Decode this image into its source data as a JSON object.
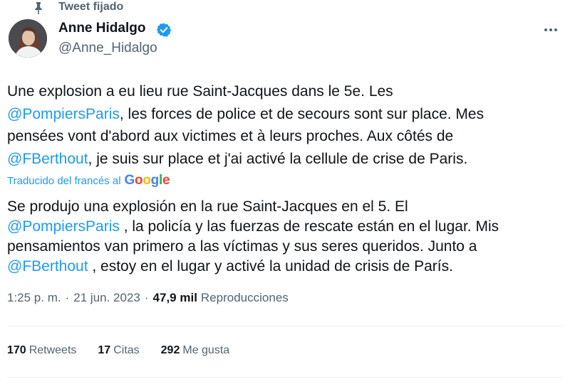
{
  "pinned": {
    "label": "Tweet fijado",
    "icon": "pin-icon"
  },
  "author": {
    "name": "Anne Hidalgo",
    "handle": "@Anne_Hidalgo",
    "verified": true,
    "verified_color": "#1d9bf0",
    "avatar_icon": "avatar-photo"
  },
  "more_icon": "more-options-icon",
  "tweet": {
    "lines": [
      [
        {
          "text": "Une explosion a eu lieu rue Saint-Jacques dans le 5e. Les"
        }
      ],
      [
        {
          "text": "@PompiersParis",
          "mention": true
        },
        {
          "text": ", les forces de police et de secours sont sur place. Mes"
        }
      ],
      [
        {
          "text": "pensées vont d'abord aux victimes et à leurs proches. Aux côtés de"
        }
      ],
      [
        {
          "text": "@FBerthout",
          "mention": true
        },
        {
          "text": ", je suis sur place et j'ai activé la cellule de crise de Paris."
        }
      ]
    ]
  },
  "translation": {
    "label": "Traducido del francés al",
    "google": [
      "G",
      "o",
      "o",
      "g",
      "l",
      "e"
    ],
    "google_colors": [
      "#4285f4",
      "#ea4335",
      "#fbbc05",
      "#4285f4",
      "#34a853",
      "#ea4335"
    ],
    "lines": [
      [
        {
          "text": "Se produjo una explosión en la rue Saint-Jacques en el 5. El"
        }
      ],
      [
        {
          "text": "@PompiersParis",
          "mention": true
        },
        {
          "text": " , la policía y las fuerzas de rescate están en el lugar. Mis"
        }
      ],
      [
        {
          "text": "pensamientos van primero a las víctimas y sus seres queridos. Junto a"
        }
      ],
      [
        {
          "text": "@FBerthout",
          "mention": true
        },
        {
          "text": " , estoy en el lugar y activé la unidad de crisis de París."
        }
      ]
    ]
  },
  "meta": {
    "time": "1:25 p. m.",
    "sep1": "·",
    "date": "21 jun. 2023",
    "sep2": "·",
    "views_count": "47,9 mil",
    "views_label": "Reproducciones"
  },
  "stats": [
    {
      "num": "170",
      "label": "Retweets",
      "name": "retweets-stat"
    },
    {
      "num": "17",
      "label": "Citas",
      "name": "quotes-stat"
    },
    {
      "num": "292",
      "label": "Me gusta",
      "name": "likes-stat"
    }
  ],
  "colors": {
    "accent": "#1d9bf0",
    "text": "#0f1419",
    "secondary": "#536471",
    "divider": "#eff3f4"
  }
}
